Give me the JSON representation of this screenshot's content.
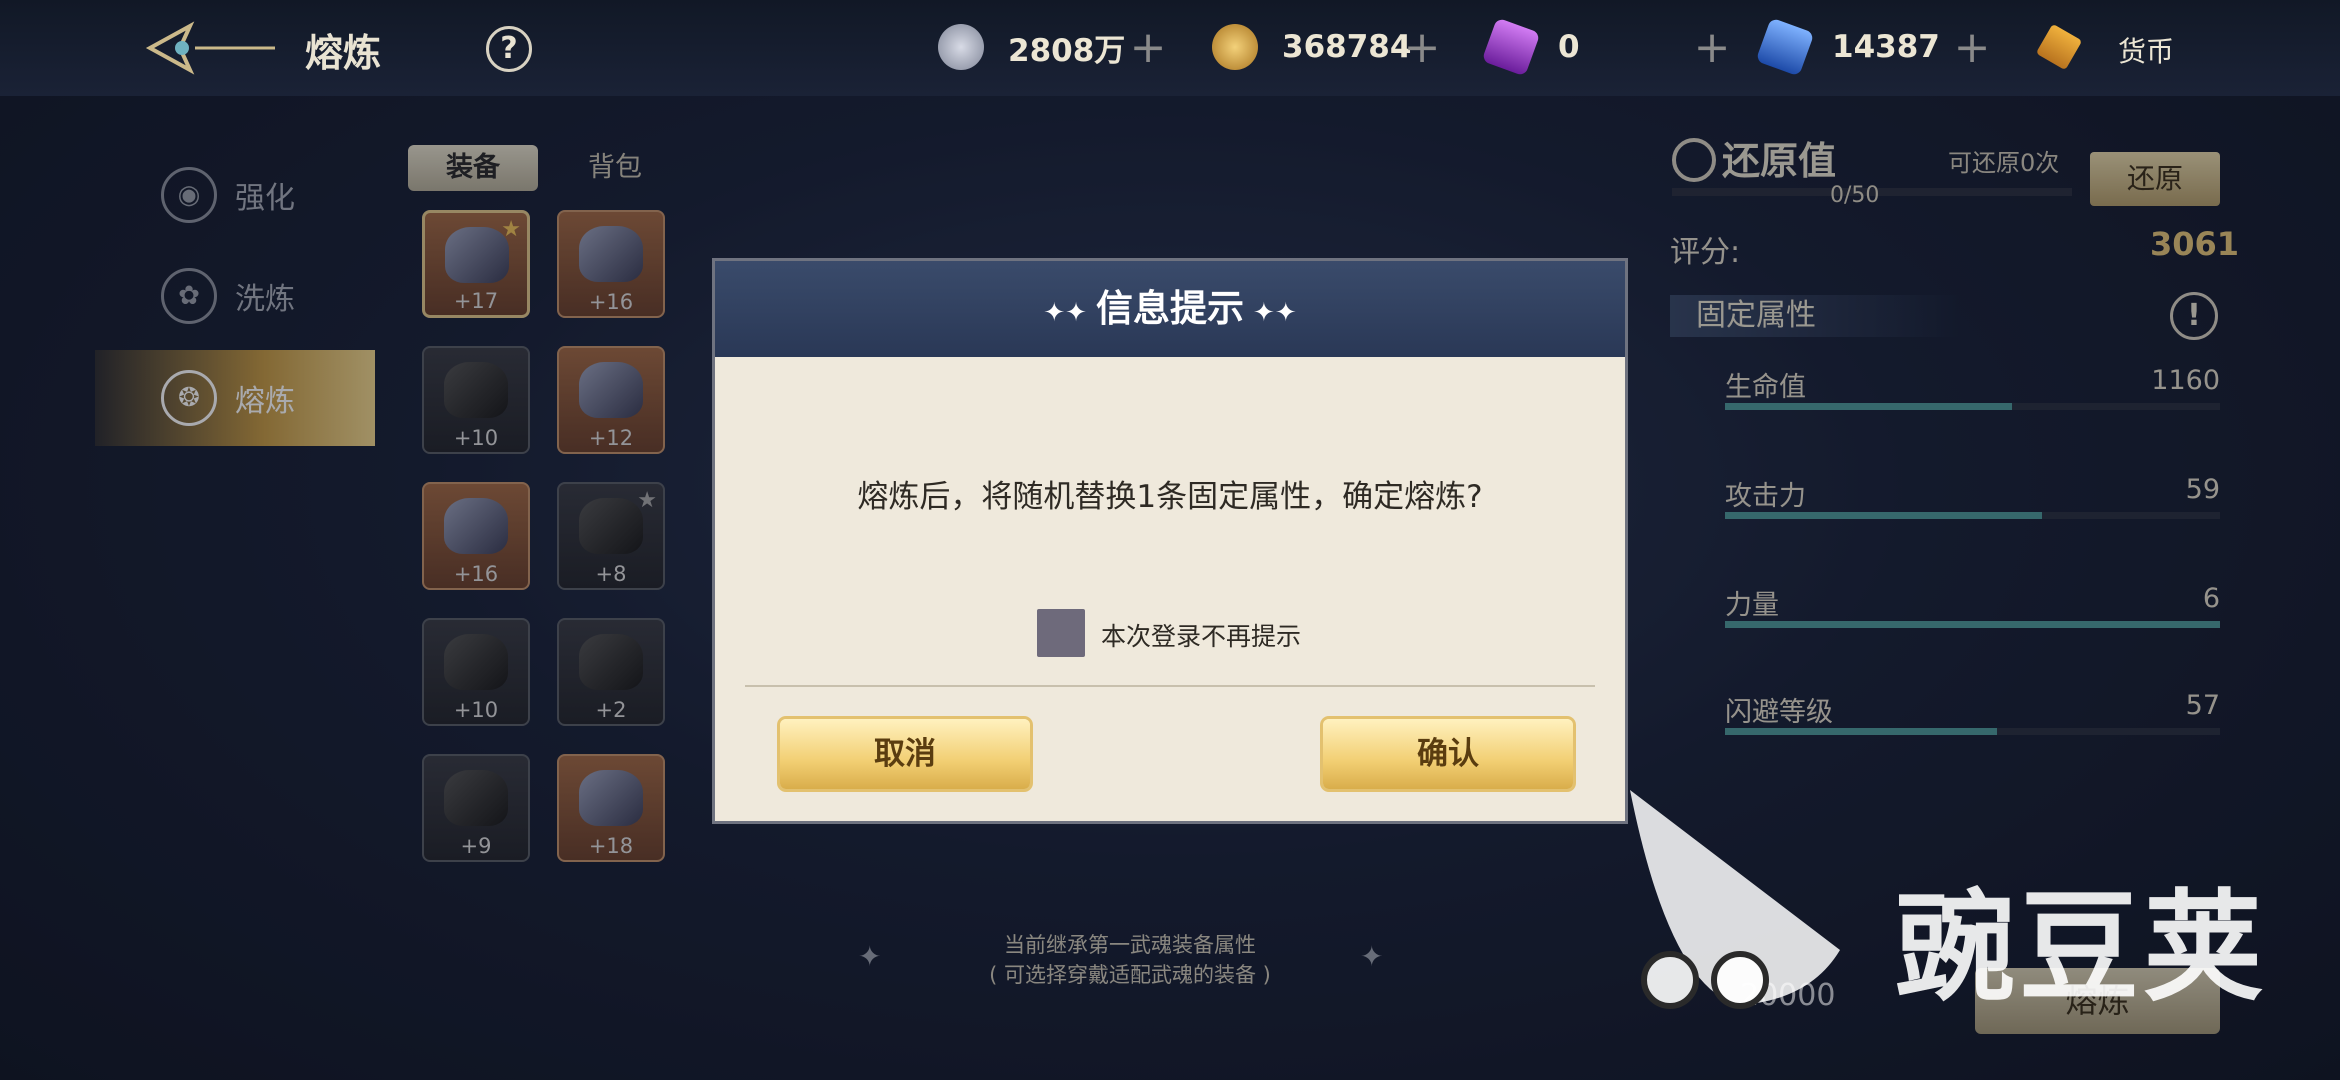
{
  "header": {
    "title": "熔炼",
    "help": "?",
    "currencies": [
      {
        "icon": "silver-coin-icon",
        "value": "2808万",
        "plus": "+",
        "color": "#b8bccd"
      },
      {
        "icon": "gold-coin-icon",
        "value": "368784",
        "plus": "+",
        "color": "#d4a23e"
      },
      {
        "icon": "purple-gem-icon",
        "value": "0",
        "plus": "+",
        "color": "#a43ad6"
      },
      {
        "icon": "blue-crystal-icon",
        "value": "14387",
        "plus": "+",
        "color": "#3f77d8"
      }
    ],
    "currency_label": "货币"
  },
  "nav": [
    {
      "label": "强化",
      "icon": "enhance-icon"
    },
    {
      "label": "洗炼",
      "icon": "refine-icon"
    },
    {
      "label": "熔炼",
      "icon": "smelt-icon",
      "active": true
    }
  ],
  "tabs": {
    "equip": "装备",
    "bag": "背包"
  },
  "items": [
    {
      "level": "+17",
      "rarity": "orange",
      "starred": true,
      "selected": true
    },
    {
      "level": "+16",
      "rarity": "orange"
    },
    {
      "level": "+10",
      "rarity": "gray"
    },
    {
      "level": "+12",
      "rarity": "orange"
    },
    {
      "level": "+16",
      "rarity": "orange"
    },
    {
      "level": "+8",
      "rarity": "gray",
      "starred": true
    },
    {
      "level": "+10",
      "rarity": "gray"
    },
    {
      "level": "+2",
      "rarity": "gray"
    },
    {
      "level": "+9",
      "rarity": "gray"
    },
    {
      "level": "+18",
      "rarity": "orange"
    }
  ],
  "restore": {
    "title": "还原值",
    "count_text": "可还原0次",
    "button": "还原",
    "progress_text": "0/50",
    "progress": 0
  },
  "score": {
    "label": "评分:",
    "value": "3061"
  },
  "fixed_attrs": {
    "title": "固定属性",
    "info": "!",
    "stats": [
      {
        "name": "生命值",
        "value": "1160",
        "fill": 0.58
      },
      {
        "name": "攻击力",
        "value": "59",
        "fill": 0.64
      },
      {
        "name": "力量",
        "value": "6",
        "fill": 1.0
      },
      {
        "name": "闪避等级",
        "value": "57",
        "fill": 0.55
      }
    ]
  },
  "bottom": {
    "hint_line1": "当前继承第一武魂装备属性",
    "hint_line2": "( 可选择穿戴适配武魂的装备 )",
    "cost": "20000",
    "smelt_button": "熔炼"
  },
  "dialog": {
    "title": "信息提示",
    "message": "熔炼后，将随机替换1条固定属性，确定熔炼?",
    "checkbox_label": "本次登录不再提示",
    "cancel": "取消",
    "confirm": "确认"
  },
  "watermark": {
    "text": "豌豆荚"
  }
}
